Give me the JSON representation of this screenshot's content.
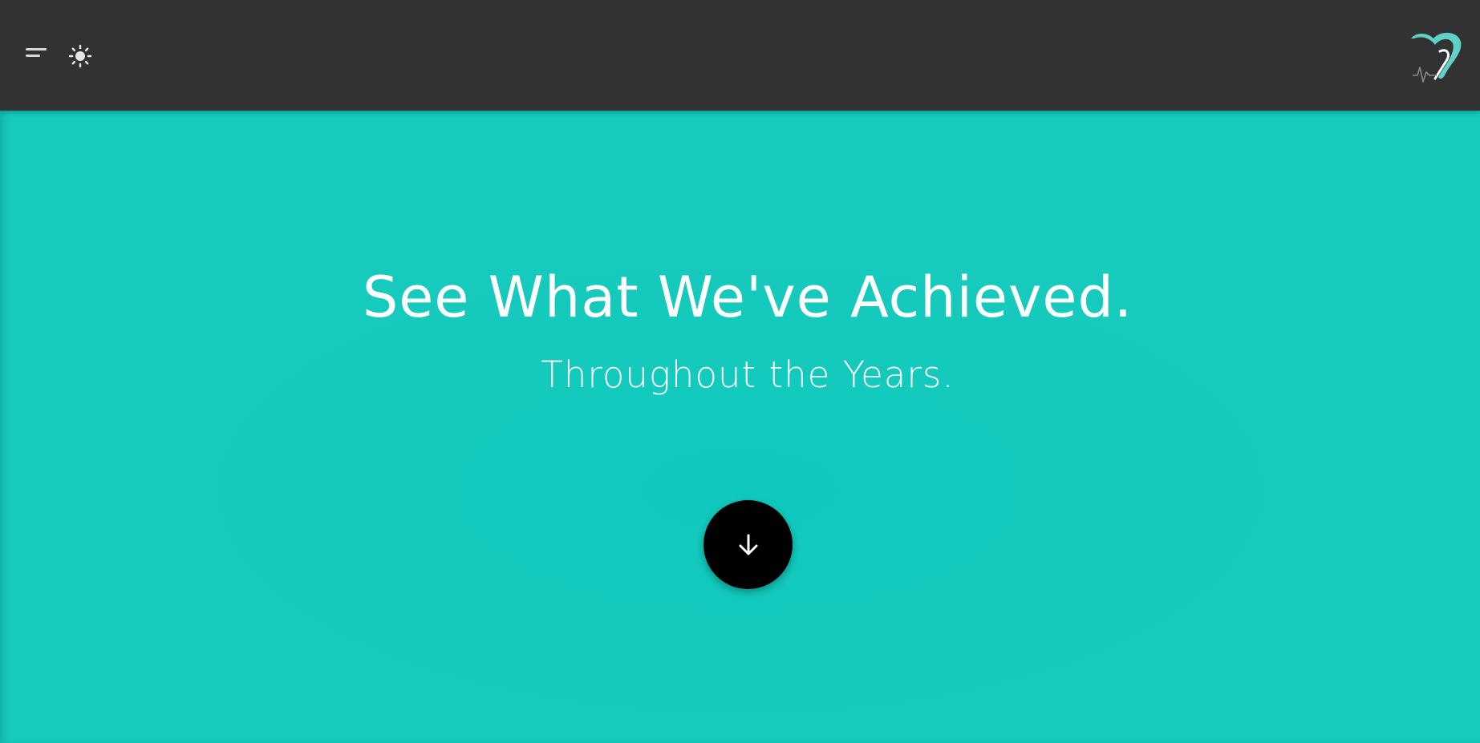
{
  "header": {
    "menu_icon": "menu-icon",
    "theme_icon": "sun-icon",
    "logo_icon": "heart-logo-icon",
    "colors": {
      "background": "#323232",
      "icon": "#d9d9d9",
      "logo_accent": "#5fd1c7"
    }
  },
  "hero": {
    "title": "See What We've Achieved.",
    "subtitle": "Throughout the Years.",
    "scroll_icon": "arrow-down-icon",
    "colors": {
      "background": "#16cabd",
      "text": "#ffffff",
      "button": "#000000"
    }
  }
}
